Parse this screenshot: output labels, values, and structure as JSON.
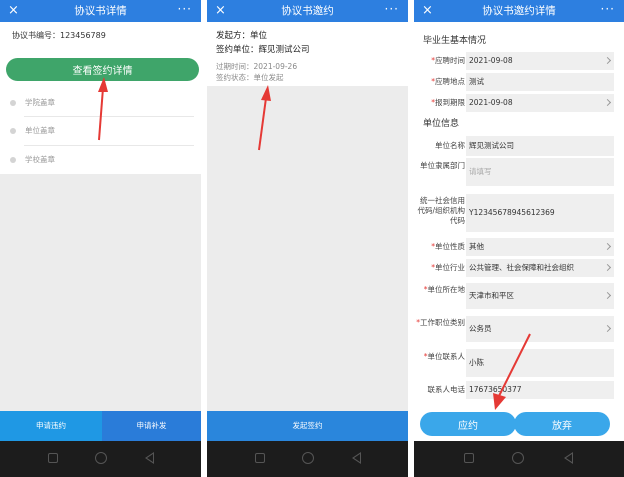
{
  "colors": {
    "topbar": "#2d7fe0",
    "green_button": "#3fa56a",
    "blue_button": "#3aa7ea",
    "annotation_arrow": "#e53935",
    "required_mark": "#e53935"
  },
  "panel1": {
    "title": "协议书详情",
    "close": "×",
    "more": "···",
    "agreement_no": "协议书编号：123456789",
    "view_button": "查看签约详情",
    "steps": [
      "学院盖章",
      "单位盖章",
      "学校盖章"
    ],
    "btn_breach": "申请违约",
    "btn_reissue": "申请补发"
  },
  "panel2": {
    "title": "协议书邀约",
    "close": "×",
    "more": "···",
    "initiator": "发起方：单位",
    "signing_unit": "签约单位：辉见测试公司",
    "expiry": "过期时间：2021-09-26",
    "status": "签约状态：单位发起",
    "btn_initiate": "发起签约"
  },
  "panel3": {
    "title": "协议书邀约详情",
    "close": "×",
    "more": "···",
    "section_grad": "毕业生基本情况",
    "section_unit": "单位信息",
    "required_mark": "*",
    "fields": [
      {
        "label": "应聘时间",
        "value": "2021-09-08"
      },
      {
        "label": "应聘地点",
        "value": "测试"
      },
      {
        "label": "报到期限",
        "value": "2021-09-08"
      },
      {
        "label": "单位名称",
        "value": "辉见测试公司"
      },
      {
        "label": "单位隶属部门",
        "placeholder": "请填写"
      },
      {
        "label": "统一社会信用代码/组织机构代码",
        "value": "Y12345678945612369"
      },
      {
        "label": "单位性质",
        "value": "其他"
      },
      {
        "label": "单位行业",
        "value": "公共管理、社会保障和社会组织"
      },
      {
        "label": "单位所在地",
        "value": "天津市和平区"
      },
      {
        "label": "工作职位类别",
        "value": "公务员"
      },
      {
        "label": "单位联系人",
        "value": "小陈"
      },
      {
        "label": "联系人电话",
        "value": "17673650377"
      }
    ],
    "btn_accept": "应约",
    "btn_giveup": "放弃"
  }
}
